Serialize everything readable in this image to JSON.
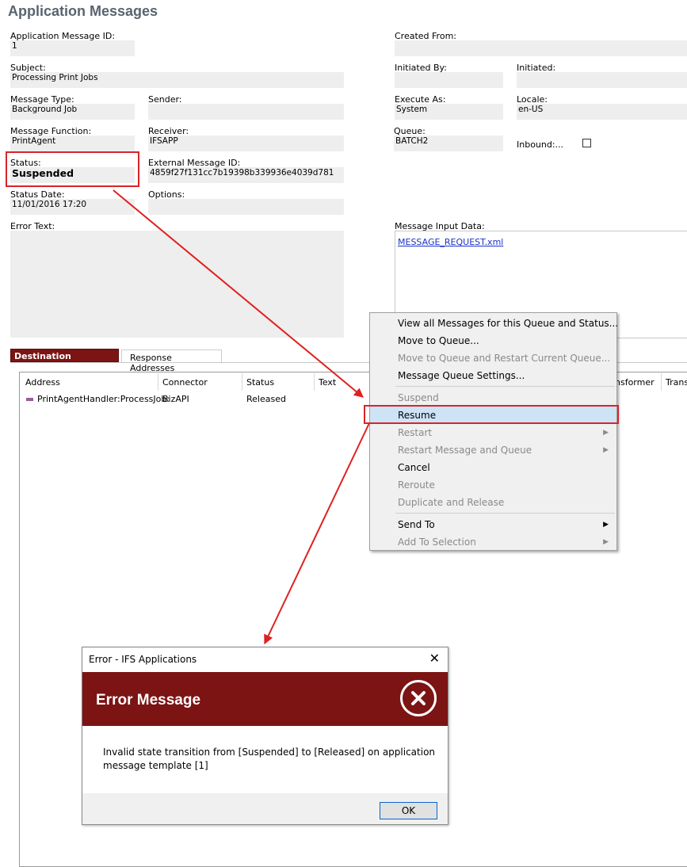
{
  "page_title": "Application Messages",
  "fields": {
    "app_msg_id_label": "Application Message ID:",
    "app_msg_id": "1",
    "subject_label": "Subject:",
    "subject": "Processing Print Jobs",
    "msg_type_label": "Message Type:",
    "msg_type": "Background Job",
    "sender_label": "Sender:",
    "sender": "",
    "msg_function_label": "Message Function:",
    "msg_function": "PrintAgent",
    "receiver_label": "Receiver:",
    "receiver": "IFSAPP",
    "status_label": "Status:",
    "status": "Suspended",
    "ext_msg_id_label": "External Message ID:",
    "ext_msg_id": "4859f27f131cc7b19398b339936e4039d781",
    "status_date_label": "Status Date:",
    "status_date": "11/01/2016 17:20",
    "options_label": "Options:",
    "options": "",
    "error_text_label": "Error Text:",
    "created_from_label": "Created From:",
    "initiated_by_label": "Initiated By:",
    "initiated_label": "Initiated:",
    "execute_as_label": "Execute As:",
    "execute_as": "System",
    "locale_label": "Locale:",
    "locale": "en-US",
    "queue_label": "Queue:",
    "queue": "BATCH2",
    "inbound_label": "Inbound:...",
    "msg_input_label": "Message Input Data:",
    "msg_input_link": "MESSAGE_REQUEST.xml"
  },
  "tabs": {
    "destination": "Destination Addresses",
    "response": "Response Addresses"
  },
  "grid": {
    "columns": [
      "Address",
      "Connector",
      "Status",
      "Text",
      "nsformer",
      "Trans"
    ],
    "rows": [
      {
        "address": "PrintAgentHandler:ProcessJob:",
        "connector": "BizAPI",
        "status": "Released"
      }
    ]
  },
  "context_menu": {
    "items": [
      {
        "label": "View all Messages for this Queue and Status...",
        "disabled": false
      },
      {
        "label": "Move to Queue...",
        "disabled": false
      },
      {
        "label": "Move to Queue and Restart Current Queue...",
        "disabled": true
      },
      {
        "label": "Message Queue Settings...",
        "disabled": false
      },
      {
        "label": "Suspend",
        "disabled": true
      },
      {
        "label": "Resume",
        "disabled": false,
        "highlighted": true
      },
      {
        "label": "Restart",
        "disabled": true,
        "submenu": true
      },
      {
        "label": "Restart Message and Queue",
        "disabled": true,
        "submenu": true
      },
      {
        "label": "Cancel",
        "disabled": false
      },
      {
        "label": "Reroute",
        "disabled": true
      },
      {
        "label": "Duplicate and Release",
        "disabled": true
      },
      {
        "label": "Send To",
        "disabled": false,
        "submenu": true
      },
      {
        "label": "Add To Selection",
        "disabled": true,
        "submenu": true
      }
    ],
    "arrow_glyph": "▶"
  },
  "dialog": {
    "title": "Error - IFS Applications",
    "close_glyph": "✕",
    "heading": "Error Message",
    "message": "Invalid state transition from [Suspended] to [Released] on application message template [1]",
    "ok_label": "OK"
  },
  "colors": {
    "brand": "#7c1414",
    "annotation": "#d9232a",
    "highlight": "#cde4f7"
  }
}
